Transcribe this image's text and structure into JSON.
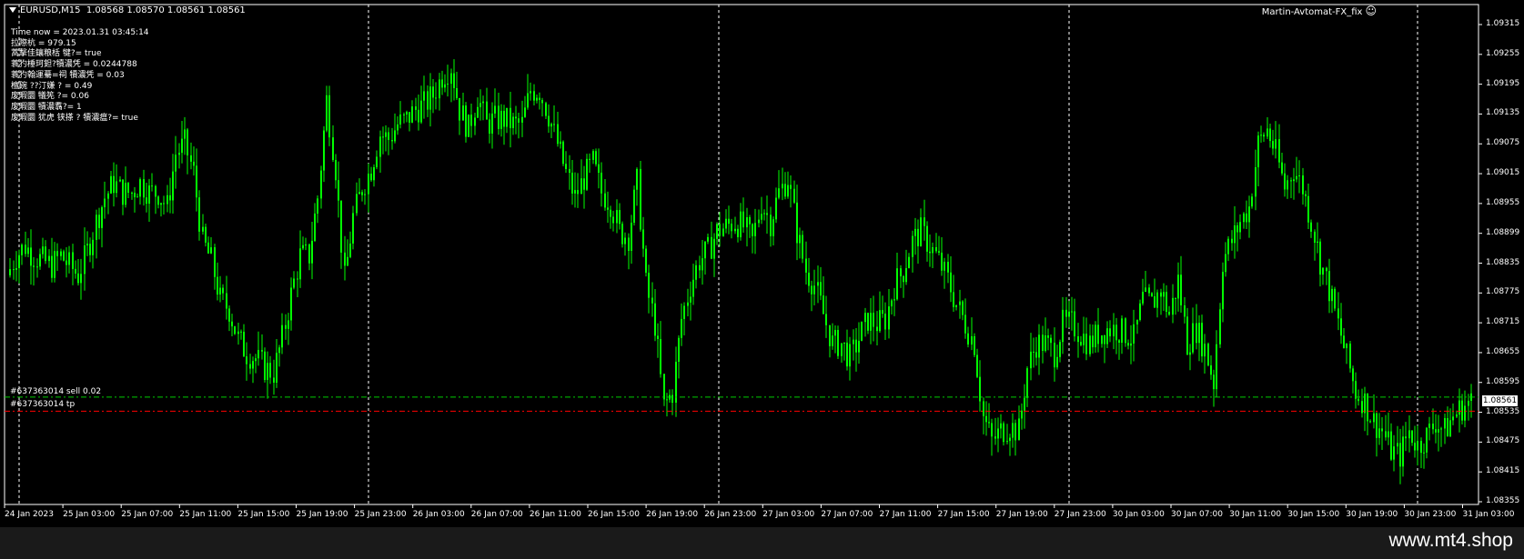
{
  "chart_header": {
    "symbol_label": "EURUSD,M15",
    "ohlc_text": "1.08568 1.08570 1.08561 1.08561"
  },
  "ea": {
    "name": "Martin-Avtomat-FX_fix"
  },
  "info_lines": [
    "Time now = 2023.01.31 03:45:14",
    "拉際杭  = 979.15",
    "蒿擊佳鑲粮栝 犍?= true",
    "蓑犳棰珂鉭?犢濃凭 = 0.0244788",
    "蓑犳翰運驀=祠 犢濃凭 = 0.03",
    "檀碗  ??汀嫌  ? = 0.49",
    "废暇圜 犠筅  ?= 0.06",
    "废暇圜 犢濃翥?= 1",
    "废暇圜 犹虎   铗搽  ? 犢濃瘟?= true"
  ],
  "orders": {
    "sell_label": "#637363014 sell 0.02",
    "tp_label": "#637363014 tp"
  },
  "current_price": "1.08561",
  "colors": {
    "candle": "#00ff00",
    "sell_line": "#00cc00",
    "tp_line": "#ff0000",
    "grid": "#ffffff",
    "background": "#000000"
  },
  "chart_data": {
    "type": "candlestick",
    "symbol": "EURUSD",
    "timeframe": "M15",
    "ylim": [
      1.08355,
      1.09335
    ],
    "y_ticks": [
      "1.09315",
      "1.09255",
      "1.09195",
      "1.09135",
      "1.09075",
      "1.09015",
      "1.08955",
      "1.08899",
      "1.08835",
      "1.08775",
      "1.08715",
      "1.08655",
      "1.08595",
      "1.08535",
      "1.08475",
      "1.08415",
      "1.08355"
    ],
    "x_ticks": [
      "24 Jan 2023",
      "25 Jan 03:00",
      "25 Jan 07:00",
      "25 Jan 11:00",
      "25 Jan 15:00",
      "25 Jan 19:00",
      "25 Jan 23:00",
      "26 Jan 03:00",
      "26 Jan 07:00",
      "26 Jan 11:00",
      "26 Jan 15:00",
      "26 Jan 19:00",
      "26 Jan 23:00",
      "27 Jan 03:00",
      "27 Jan 07:00",
      "27 Jan 11:00",
      "27 Jan 15:00",
      "27 Jan 19:00",
      "27 Jan 23:00",
      "30 Jan 03:00",
      "30 Jan 07:00",
      "30 Jan 11:00",
      "30 Jan 15:00",
      "30 Jan 19:00",
      "30 Jan 23:00",
      "31 Jan 03:00"
    ],
    "series": [
      {
        "close": [
          1.0882,
          1.0886,
          1.0888,
          1.0886,
          1.0885,
          1.0884,
          1.0886,
          1.0884,
          1.0882,
          1.0887,
          1.0893,
          1.0898,
          1.0901,
          1.0899,
          1.0899,
          1.0901,
          1.0899,
          1.0899,
          1.0896,
          1.0907,
          1.0909,
          1.0903,
          1.0889,
          1.0885,
          1.0877,
          1.0875,
          1.0869,
          1.0866,
          1.0865,
          1.0863,
          1.0862,
          1.0869,
          1.0878,
          1.0886,
          1.0886,
          1.0898,
          1.0918,
          1.0904,
          1.0881,
          1.0894,
          1.09,
          1.0904,
          1.0911,
          1.091,
          1.0913,
          1.0914,
          1.0916,
          1.0917,
          1.0919,
          1.0923,
          1.0925,
          1.0916,
          1.0912,
          1.0919,
          1.0913,
          1.0914,
          1.0914,
          1.0913,
          1.0913,
          1.092,
          1.092,
          1.0915,
          1.0909,
          1.0903,
          1.0898,
          1.0902,
          1.0905,
          1.0899,
          1.0897,
          1.0891,
          1.089,
          1.0901,
          1.088,
          1.0872,
          1.0855,
          1.0858,
          1.0873,
          1.088,
          1.0885,
          1.0887,
          1.0891,
          1.0892,
          1.0893,
          1.0892,
          1.0889,
          1.0897,
          1.0893,
          1.0899,
          1.0902,
          1.0891,
          1.0883,
          1.088,
          1.0874,
          1.0868,
          1.0868,
          1.0865,
          1.0869,
          1.0873,
          1.0872,
          1.0873,
          1.088,
          1.0883,
          1.0889,
          1.0891,
          1.0888,
          1.0885,
          1.0881,
          1.0876,
          1.0872,
          1.0868,
          1.0853,
          1.0848,
          1.085,
          1.0851,
          1.085,
          1.0863,
          1.0868,
          1.0868,
          1.0866,
          1.0872,
          1.0872,
          1.087,
          1.0868,
          1.087,
          1.0871,
          1.0871,
          1.087,
          1.0869,
          1.0877,
          1.0876,
          1.0879,
          1.0874,
          1.0881,
          1.0868,
          1.0871,
          1.0867,
          1.086,
          1.0885,
          1.0889,
          1.0893,
          1.0896,
          1.0909,
          1.0912,
          1.0907,
          1.09,
          1.0904,
          1.09,
          1.0893,
          1.0885,
          1.0879,
          1.0872,
          1.0865,
          1.0858,
          1.0856,
          1.0852,
          1.085,
          1.0846,
          1.0845,
          1.085,
          1.0847,
          1.0849,
          1.0852,
          1.085,
          1.0853,
          1.0855,
          1.0856
        ]
      }
    ]
  }
}
